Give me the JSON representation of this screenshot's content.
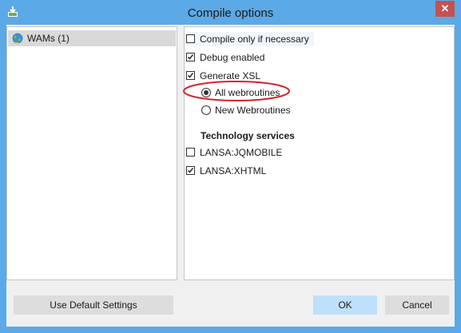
{
  "window": {
    "title": "Compile options",
    "close_label": "✕"
  },
  "tree": {
    "items": [
      {
        "label": "WAMs (1)"
      }
    ]
  },
  "options": {
    "compile_only": {
      "label": "Compile only if necessary",
      "checked": false
    },
    "debug_enabled": {
      "label": "Debug enabled",
      "checked": true
    },
    "generate_xsl": {
      "label": "Generate XSL",
      "checked": true
    },
    "all_webroutines": {
      "label": "All webroutines",
      "selected": true
    },
    "new_webroutines": {
      "label": "New Webroutines",
      "selected": false
    }
  },
  "technology": {
    "heading": "Technology services",
    "items": [
      {
        "label": "LANSA:JQMOBILE",
        "checked": false
      },
      {
        "label": "LANSA:XHTML",
        "checked": true
      }
    ]
  },
  "buttons": {
    "default_label": "Use Default Settings",
    "ok_label": "OK",
    "cancel_label": "Cancel"
  },
  "colors": {
    "title_bar": "#5ba9e6",
    "close_button": "#c75050",
    "annotation": "#d6202a",
    "ok_button": "#bfe0fb"
  }
}
